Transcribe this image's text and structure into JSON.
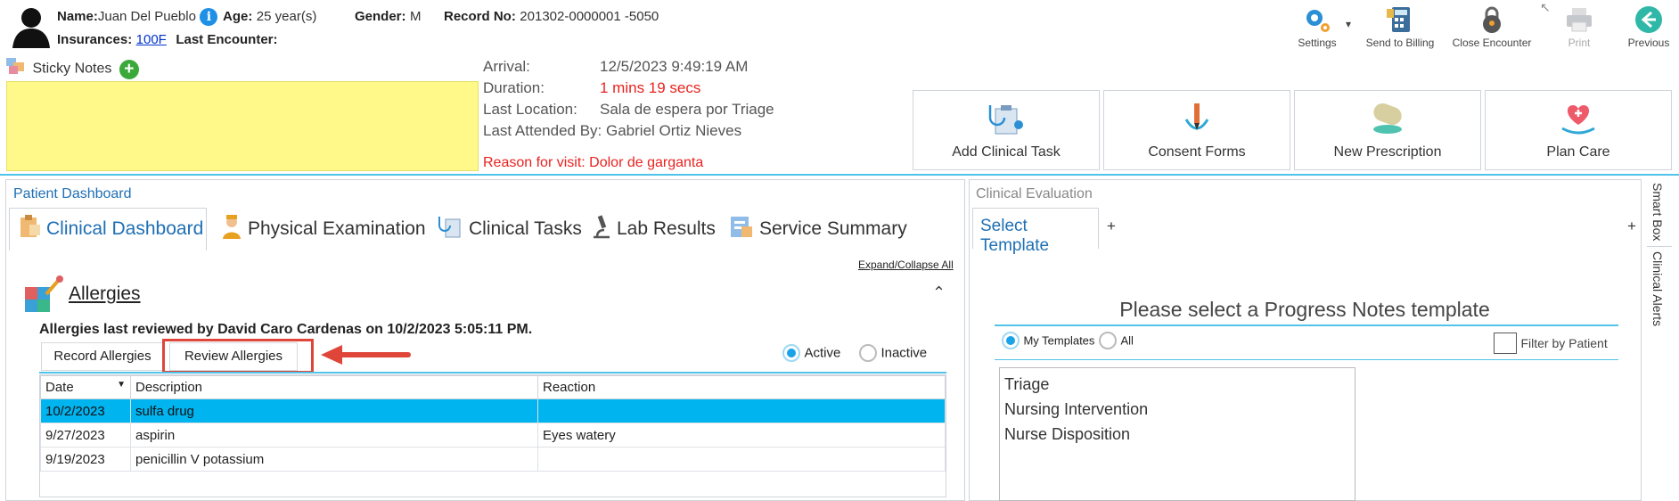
{
  "header": {
    "name_label": "Name:",
    "name_value": "Juan Del Pueblo",
    "age_label": "Age:",
    "age_value": "25 year(s)",
    "gender_label": "Gender:",
    "gender_value": "M",
    "record_label": "Record No:",
    "record_value": "201302-0000001 -5050",
    "insurance_label": "Insurances:",
    "insurance_value": "100F",
    "last_encounter_label": "Last Encounter:"
  },
  "toolbar": {
    "settings": "Settings",
    "send_to_billing": "Send to Billing",
    "close_encounter": "Close Encounter",
    "print": "Print",
    "previous": "Previous"
  },
  "sticky": {
    "title": "Sticky Notes",
    "add": "+"
  },
  "encounter": {
    "arrival_label": "Arrival:",
    "arrival_value": "12/5/2023 9:49:19 AM",
    "duration_label": "Duration:",
    "duration_value": "1 mins 19 secs",
    "location_label": "Last Location:",
    "location_value": "Sala de espera por Triage",
    "attended_label": "Last Attended By:",
    "attended_value": "Gabriel Ortiz Nieves",
    "reason": "Reason for visit: Dolor de garganta"
  },
  "actions": {
    "add_task": "Add Clinical Task",
    "consent": "Consent Forms",
    "prescription": "New Prescription",
    "plan_care": "Plan Care"
  },
  "dashboard": {
    "title": "Patient Dashboard",
    "tabs": [
      "Clinical Dashboard",
      "Physical Examination",
      "Clinical Tasks",
      "Lab Results",
      "Service Summary"
    ],
    "expand_collapse": "Expand/Collapse All",
    "allergies_title": "Allergies",
    "collapse_glyph": "⌃",
    "reviewed": "Allergies last reviewed by David Caro Cardenas on 10/2/2023 5:05:11 PM.",
    "record_btn": "Record Allergies",
    "review_btn": "Review Allergies",
    "active": "Active",
    "inactive": "Inactive",
    "columns": [
      "Date",
      "Description",
      "Reaction"
    ],
    "rows": [
      [
        "10/2/2023",
        "sulfa drug",
        ""
      ],
      [
        "9/27/2023",
        "aspirin",
        "Eyes watery"
      ],
      [
        "9/19/2023",
        "penicillin V potassium",
        ""
      ]
    ]
  },
  "clinical_eval": {
    "title": "Clinical Evaluation",
    "tab": "Select Template",
    "plus": "+",
    "prompt": "Please select a Progress Notes template",
    "my_templates": "My Templates",
    "all": "All",
    "filter": "Filter by Patient",
    "templates": [
      "Triage",
      "Nursing Intervention",
      "Nurse Disposition"
    ]
  },
  "side": {
    "smart_box": "Smart Box",
    "clinical_alerts": "Clinical Alerts"
  },
  "colors": {
    "accent": "#1e6fb4",
    "selected_row": "#00b4f0",
    "sticky": "#fff98a",
    "alert_red": "#e8231f"
  }
}
